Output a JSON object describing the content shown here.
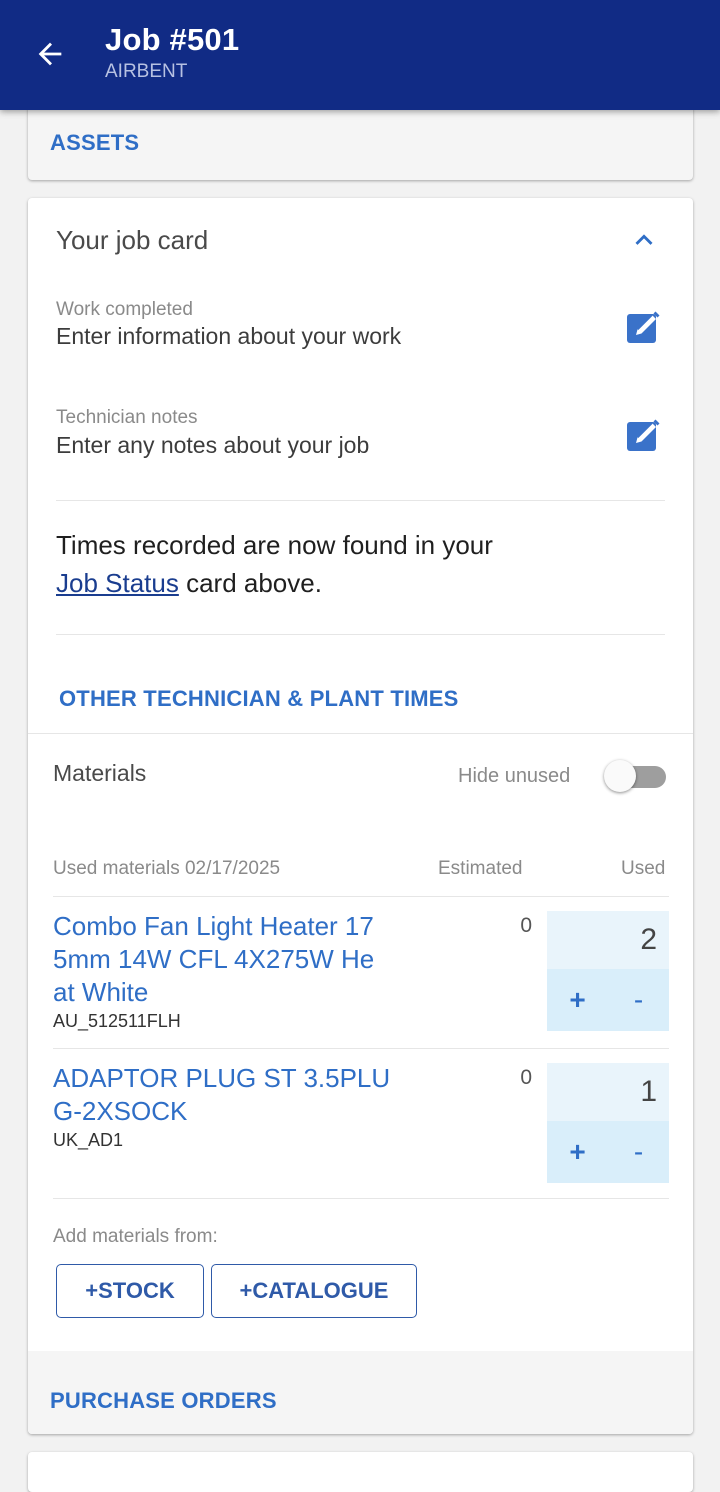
{
  "header": {
    "title": "Job #501",
    "subtitle": "AIRBENT"
  },
  "assets": {
    "label": "ASSETS"
  },
  "job_card": {
    "title": "Your job card",
    "work_completed": {
      "label": "Work completed",
      "placeholder": "Enter information about your work"
    },
    "technician_notes": {
      "label": "Technician notes",
      "placeholder": "Enter any notes about your job"
    },
    "times_text_prefix": "Times recorded are now found in your",
    "times_link": "Job Status",
    "times_text_suffix": " card above.",
    "other_times": "OTHER TECHNICIAN & PLANT TIMES"
  },
  "materials": {
    "title": "Materials",
    "hide_unused_label": "Hide unused",
    "hide_unused_on": false,
    "columns": {
      "used_materials": "Used materials 02/17/2025",
      "estimated": "Estimated",
      "used": "Used"
    },
    "items": [
      {
        "name": "Combo Fan Light Heater 175mm 14W CFL 4X275W Heat White",
        "name_lines": [
          "Combo Fan Light Heater 17",
          "5mm 14W CFL 4X275W He",
          "at White"
        ],
        "code": "AU_512511FLH",
        "estimated": "0",
        "used": "2"
      },
      {
        "name": "ADAPTOR PLUG ST 3.5PLUG-2XSOCK",
        "name_lines": [
          "ADAPTOR PLUG ST 3.5PLU",
          "G-2XSOCK"
        ],
        "code": "UK_AD1",
        "estimated": "0",
        "used": "1"
      }
    ],
    "plus": "+",
    "minus": "-",
    "add_from_label": "Add materials from:",
    "stock_button": "+STOCK",
    "catalogue_button": "+CATALOGUE"
  },
  "purchase_orders": {
    "label": "PURCHASE ORDERS"
  },
  "colors": {
    "appbar": "#112b85",
    "accent": "#2f6ec6",
    "link": "#1a3d8f",
    "qty_bg": "#e9f4fb"
  }
}
